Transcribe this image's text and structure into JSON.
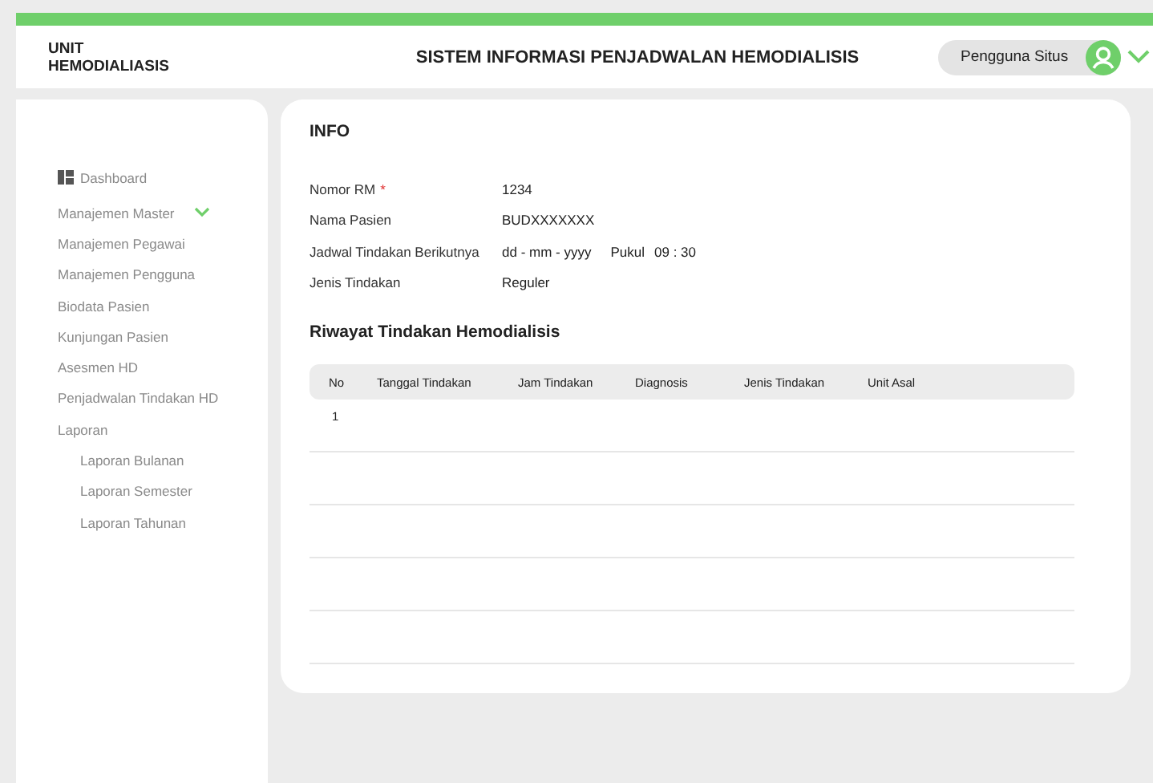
{
  "header": {
    "unit_lines": [
      "UNIT",
      "HEMODIALIASIS"
    ],
    "title": "SISTEM INFORMASI PENJADWALAN HEMODIALISIS",
    "user": "Pengguna Situs"
  },
  "sidebar": {
    "items": [
      {
        "label": "Dashboard",
        "kind": "dashboard"
      },
      {
        "label": "Manajemen Master",
        "kind": "group",
        "expanded": true
      },
      {
        "label": "Manajemen Pegawai",
        "kind": "item"
      },
      {
        "label": "Manajemen Pengguna",
        "kind": "item"
      },
      {
        "label": "Biodata Pasien",
        "kind": "item"
      },
      {
        "label": "Kunjungan Pasien",
        "kind": "item"
      },
      {
        "label": "Asesmen HD",
        "kind": "item"
      },
      {
        "label": "Penjadwalan Tindakan HD",
        "kind": "item"
      },
      {
        "label": "Laporan",
        "kind": "item",
        "children": [
          {
            "label": "Laporan Bulanan"
          },
          {
            "label": "Laporan Semester"
          },
          {
            "label": "Laporan Tahunan"
          }
        ]
      }
    ]
  },
  "info": {
    "title": "INFO",
    "fields": [
      {
        "label": "Nomor RM",
        "required_mark": "*",
        "value": "1234"
      },
      {
        "label": "Nama Pasien",
        "value": "BUDXXXXXXX"
      },
      {
        "label": "Jadwal Tindakan Berikutnya",
        "value": "dd - mm - yyyy",
        "time_label": "Pukul",
        "time": "09 : 30"
      },
      {
        "label": "Jenis Tindakan",
        "value": "Reguler"
      }
    ]
  },
  "history": {
    "title": "Riwayat Tindakan Hemodialisis",
    "columns": [
      "No",
      "Tanggal Tindakan",
      "Jam Tindakan",
      "Diagnosis",
      "Jenis Tindakan",
      "Unit Asal"
    ],
    "rows": [
      {
        "cells": [
          "1"
        ]
      }
    ]
  }
}
